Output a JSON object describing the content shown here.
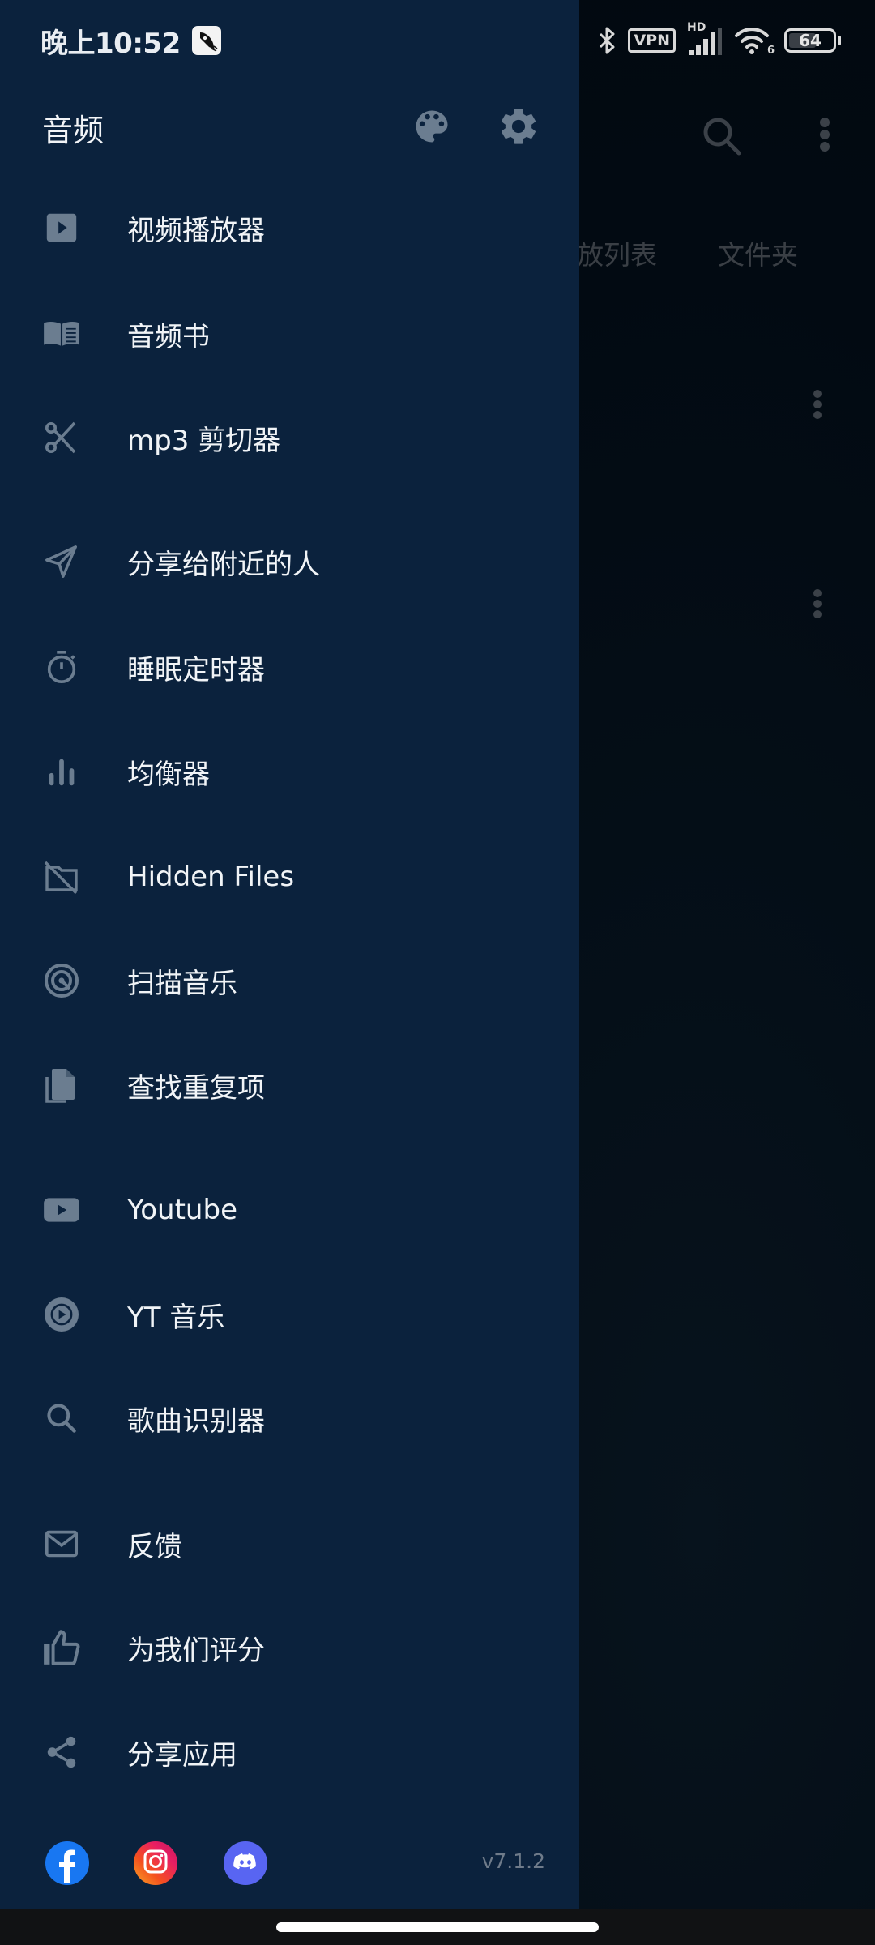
{
  "status_bar": {
    "time": "晚上10:52",
    "notification_icon": "rocket-app-icon",
    "icons": [
      "bluetooth-icon",
      "vpn-icon",
      "cellular-signal-icon",
      "wifi-icon"
    ],
    "vpn_label": "VPN",
    "cellular_label": "HD",
    "wifi_label": "6",
    "battery_percent": 64,
    "battery_label": "64"
  },
  "background_app": {
    "tabs": [
      "放列表",
      "文件夹"
    ],
    "icons": [
      "search-icon",
      "more-vert-icon"
    ]
  },
  "drawer": {
    "title": "音频",
    "header_actions": [
      {
        "name": "theme",
        "icon": "palette-icon"
      },
      {
        "name": "settings",
        "icon": "gear-icon"
      }
    ],
    "items": [
      {
        "id": "video-player",
        "label": "视频播放器",
        "icon": "play-box-icon"
      },
      {
        "id": "audiobook",
        "label": "音频书",
        "icon": "book-icon"
      },
      {
        "id": "mp3-cutter",
        "label": "mp3 剪切器",
        "icon": "scissors-icon"
      },
      {
        "id": "share-nearby",
        "label": "分享给附近的人",
        "icon": "send-icon"
      },
      {
        "id": "sleep-timer",
        "label": "睡眠定时器",
        "icon": "timer-icon"
      },
      {
        "id": "equalizer",
        "label": "均衡器",
        "icon": "equalizer-icon"
      },
      {
        "id": "hidden-files",
        "label": "Hidden Files",
        "icon": "folder-off-icon"
      },
      {
        "id": "scan-music",
        "label": "扫描音乐",
        "icon": "scan-icon"
      },
      {
        "id": "find-duplicates",
        "label": "查找重复项",
        "icon": "copy-file-icon"
      },
      {
        "id": "youtube",
        "label": "Youtube",
        "icon": "youtube-icon"
      },
      {
        "id": "yt-music",
        "label": "YT 音乐",
        "icon": "yt-music-icon"
      },
      {
        "id": "song-recognizer",
        "label": "歌曲识别器",
        "icon": "search-icon"
      },
      {
        "id": "feedback",
        "label": "反馈",
        "icon": "mail-icon"
      },
      {
        "id": "rate-us",
        "label": "为我们评分",
        "icon": "thumb-up-icon"
      },
      {
        "id": "share-app",
        "label": "分享应用",
        "icon": "share-icon"
      }
    ],
    "social": [
      {
        "name": "facebook",
        "icon": "facebook-icon",
        "color": "#1877f2"
      },
      {
        "name": "instagram",
        "icon": "instagram-icon",
        "color": "#e1306c"
      },
      {
        "name": "discord",
        "icon": "discord-icon",
        "color": "#5865f2"
      }
    ],
    "version": "v7.1.2"
  },
  "colors": {
    "drawer_bg": "#0b223d",
    "icon_gray": "#6b7d90",
    "text": "#f1f4f7",
    "version_text": "#6f7b8a"
  }
}
